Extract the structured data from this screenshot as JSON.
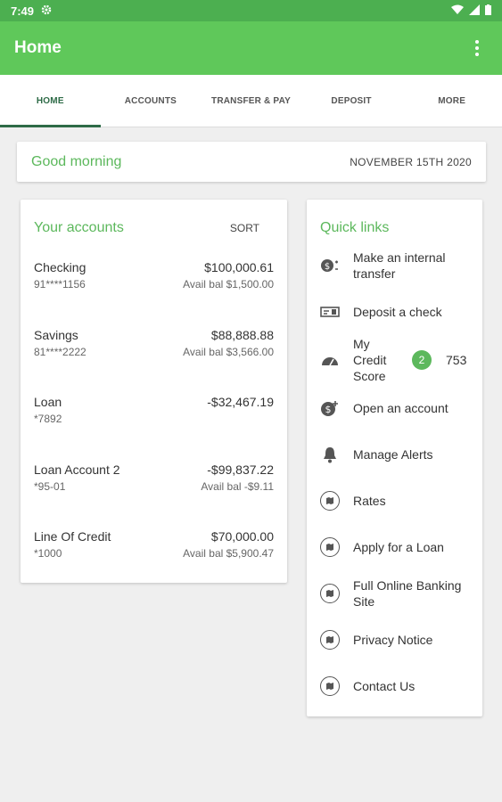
{
  "status": {
    "time": "7:49"
  },
  "app_bar": {
    "title": "Home"
  },
  "tabs": [
    {
      "label": "HOME"
    },
    {
      "label": "ACCOUNTS"
    },
    {
      "label": "TRANSFER & PAY"
    },
    {
      "label": "DEPOSIT"
    },
    {
      "label": "MORE"
    }
  ],
  "greeting": {
    "text": "Good morning",
    "date": "NOVEMBER 15TH 2020"
  },
  "accounts": {
    "title": "Your accounts",
    "sort_label": "SORT",
    "items": [
      {
        "name": "Checking",
        "number": "91****1156",
        "balance": "$100,000.61",
        "available": "Avail bal $1,500.00"
      },
      {
        "name": "Savings",
        "number": "81****2222",
        "balance": "$88,888.88",
        "available": "Avail bal $3,566.00"
      },
      {
        "name": "Loan",
        "number": "*7892",
        "balance": "-$32,467.19",
        "available": ""
      },
      {
        "name": "Loan Account 2",
        "number": "*95-01",
        "balance": "-$99,837.22",
        "available": "Avail bal -$9.11"
      },
      {
        "name": "Line Of Credit",
        "number": "*1000",
        "balance": "$70,000.00",
        "available": "Avail bal $5,900.47"
      }
    ]
  },
  "quick_links": {
    "title": "Quick links",
    "items": [
      {
        "label": "Make an internal transfer",
        "icon": "transfer-icon"
      },
      {
        "label": "Deposit a check",
        "icon": "check-icon"
      },
      {
        "label": "My Credit Score",
        "icon": "gauge-icon",
        "badge": "2",
        "score": "753"
      },
      {
        "label": "Open an account",
        "icon": "dollar-plus-icon"
      },
      {
        "label": "Manage Alerts",
        "icon": "bell-icon"
      },
      {
        "label": "Rates",
        "icon": "map-icon"
      },
      {
        "label": "Apply for a Loan",
        "icon": "map-icon"
      },
      {
        "label": "Full Online Banking Site",
        "icon": "map-icon"
      },
      {
        "label": "Privacy Notice",
        "icon": "map-icon"
      },
      {
        "label": "Contact Us",
        "icon": "map-icon"
      }
    ]
  },
  "colors": {
    "primary": "#5fc85a",
    "status_bar": "#4caf50",
    "accent_text": "#5cb85c",
    "tab_active": "#2e6b47"
  }
}
